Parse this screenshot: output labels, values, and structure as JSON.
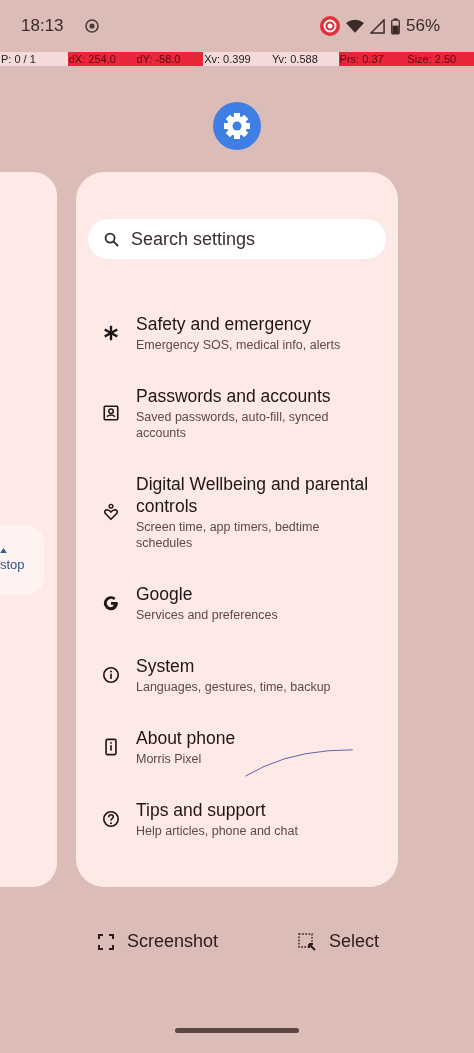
{
  "status_bar": {
    "time": "18:13",
    "battery": "56%"
  },
  "debug_overlay": [
    {
      "text": "P: 0 / 1",
      "highlighted": false
    },
    {
      "text": "dX: 254.0",
      "highlighted": true
    },
    {
      "text": "dY: -58.0",
      "highlighted": true
    },
    {
      "text": "Xv: 0.399",
      "highlighted": false
    },
    {
      "text": "Yv: 0.588",
      "highlighted": false
    },
    {
      "text": "Prs: 0.37",
      "highlighted": true
    },
    {
      "text": "Size: 2.50",
      "highlighted": true
    }
  ],
  "left_card": {
    "chip_label": "stop"
  },
  "settings_card": {
    "search": {
      "placeholder": "Search settings"
    },
    "items": [
      {
        "kind": "asterisk",
        "title": "Safety and emergency",
        "subtitle": "Emergency SOS, medical info, alerts"
      },
      {
        "kind": "account",
        "title": "Passwords and accounts",
        "subtitle": "Saved passwords, auto-fill, synced accounts"
      },
      {
        "kind": "wellbeing",
        "title": "Digital Wellbeing and parental controls",
        "subtitle": "Screen time, app timers, bedtime schedules"
      },
      {
        "kind": "google",
        "title": "Google",
        "subtitle": "Services and preferences"
      },
      {
        "kind": "info",
        "title": "System",
        "subtitle": "Languages, gestures, time, backup"
      },
      {
        "kind": "phone",
        "title": "About phone",
        "subtitle": "Morris Pixel"
      },
      {
        "kind": "help",
        "title": "Tips and support",
        "subtitle": "Help articles, phone and chat"
      }
    ]
  },
  "actions": [
    {
      "kind": "screenshot",
      "label": "Screenshot"
    },
    {
      "kind": "select",
      "label": "Select"
    }
  ]
}
